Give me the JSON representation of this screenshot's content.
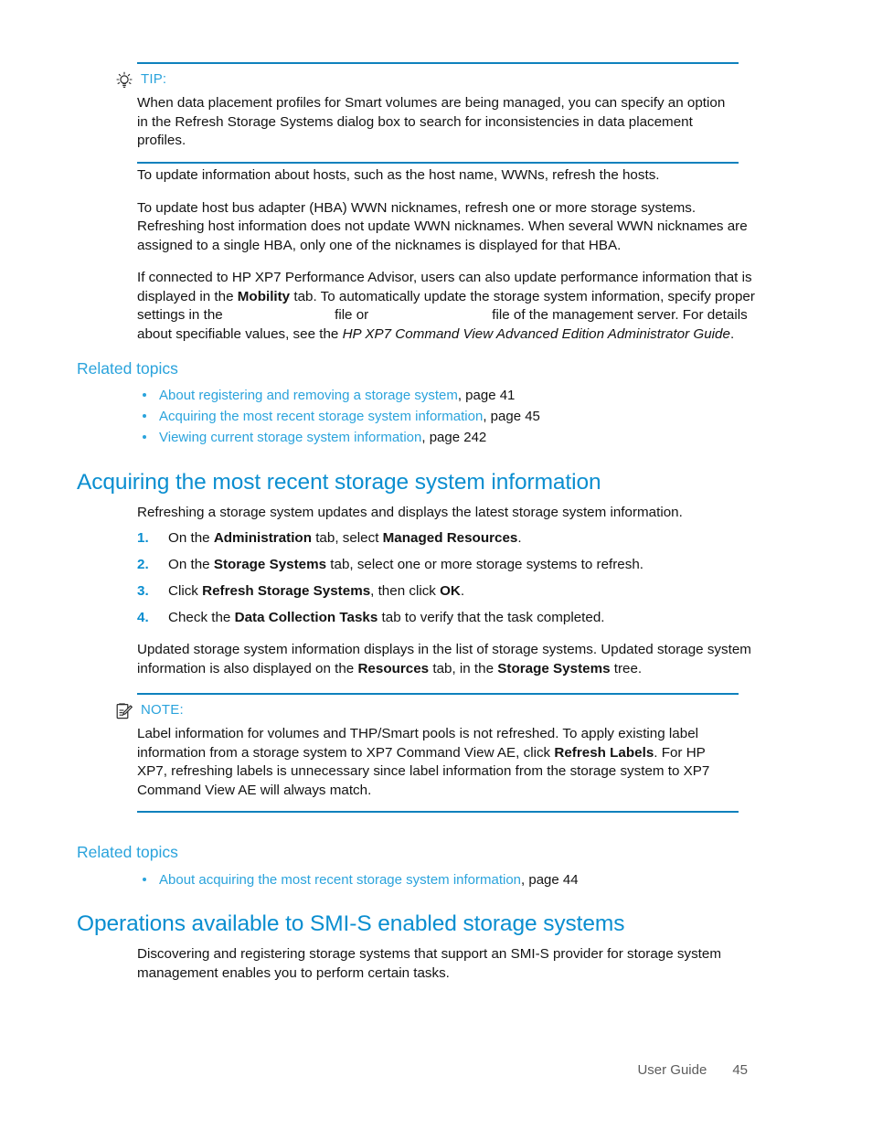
{
  "page": {
    "footer_label": "User Guide",
    "footer_page_number": "45"
  },
  "colors": {
    "heading_blue": "#0a8ed0",
    "link_blue": "#2aa3dc",
    "rule_blue": "#0e81bd",
    "body_black": "#131313",
    "footer_gray": "#5c5c5c"
  },
  "tip": {
    "icon": "lightbulb-icon",
    "label": "TIP:",
    "text_part1": "When data placement profiles for Smart volumes are being managed, you can specify an option in the Refresh Storage Systems dialog box to search for inconsistencies in data placement profiles."
  },
  "intro": {
    "p1": "To update information about hosts, such as the host name, WWNs, refresh the hosts.",
    "p2": "To update host bus adapter (HBA) WWN nicknames, refresh one or more storage systems. Refreshing host information does not update WWN nicknames. When several WWN nicknames are assigned to a single HBA, only one of the nicknames is displayed for that HBA.",
    "p3_a": "If connected to HP XP7 Performance Advisor, users can also update performance information that is displayed in the ",
    "p3_bold1": "Mobility",
    "p3_b": " tab. To automatically update the storage system information, specify proper settings in the ",
    "p3_blank1": "                            ",
    "p3_c": "file or ",
    "p3_blank2": "                               ",
    "p3_d": "file of the management server. For details about specifiable values, see the ",
    "p3_italic": "HP XP7 Command View Advanced Edition Administrator Guide",
    "p3_e": "."
  },
  "related_topics_1": {
    "heading": "Related topics",
    "items": [
      {
        "link": "About registering and removing a storage system",
        "page": ", page 41"
      },
      {
        "link": "Acquiring the most recent storage system information",
        "page": ", page 45"
      },
      {
        "link": "Viewing current storage system information",
        "page": ", page 242"
      }
    ]
  },
  "section_acquiring": {
    "heading": "Acquiring the most recent storage system information",
    "lead": "Refreshing a storage system updates and displays the latest storage system information.",
    "steps": [
      {
        "num": "1.",
        "a": "On the ",
        "b1": "Administration",
        "b": " tab, select ",
        "b2": "Managed Resources",
        "c": "."
      },
      {
        "num": "2.",
        "a": "On the ",
        "b1": "Storage Systems",
        "b": " tab, select one or more storage systems to refresh.",
        "b2": "",
        "c": ""
      },
      {
        "num": "3.",
        "a": "Click ",
        "b1": "Refresh Storage Systems",
        "b": ", then click ",
        "b2": "OK",
        "c": "."
      },
      {
        "num": "4.",
        "a": "Check the ",
        "b1": "Data Collection Tasks",
        "b": " tab to verify that the task completed.",
        "b2": "",
        "c": ""
      }
    ],
    "after_a": "Updated storage system information displays in the list of storage systems. Updated storage system information is also displayed on the ",
    "after_b1": "Resources",
    "after_b": " tab, in the ",
    "after_b2": "Storage Systems",
    "after_c": " tree."
  },
  "note": {
    "icon": "note-pencil-icon",
    "label": "NOTE:",
    "text_a": "Label information for volumes and THP/Smart pools is not refreshed. To apply existing label information from a storage system to XP7 Command View AE, click ",
    "text_bold": "Refresh Labels",
    "text_b": ". For HP XP7, refreshing labels is unnecessary since label information from the storage system to XP7 Command View AE will always match."
  },
  "related_topics_2": {
    "heading": "Related topics",
    "items": [
      {
        "link": "About acquiring the most recent storage system information",
        "page": ", page 44"
      }
    ]
  },
  "section_smis": {
    "heading": "Operations available to SMI-S enabled storage systems",
    "lead": "Discovering and registering storage systems that support an SMI-S provider for storage system management enables you to perform certain tasks."
  }
}
